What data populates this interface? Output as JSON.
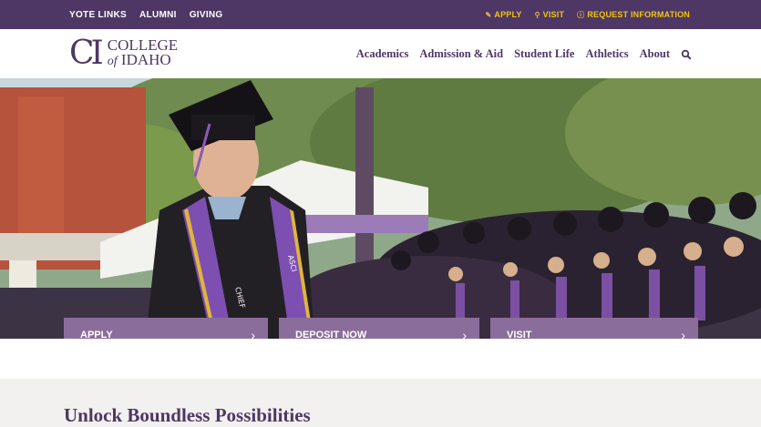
{
  "topbar": {
    "left_links": [
      "YOTE LINKS",
      "ALUMNI",
      "GIVING"
    ],
    "right_links": [
      {
        "label": "APPLY",
        "icon": "pencil-icon"
      },
      {
        "label": "VISIT",
        "icon": "map-pin-icon"
      },
      {
        "label": "REQUEST INFORMATION",
        "icon": "info-icon"
      }
    ],
    "colors": {
      "bar": "#4e3764",
      "right_link": "#f1c40f"
    }
  },
  "header": {
    "logo": {
      "mark": "CI",
      "line1": "COLLEGE",
      "of": "of",
      "line2": "IDAHO"
    },
    "nav": [
      "Academics",
      "Admission & Aid",
      "Student Life",
      "Athletics",
      "About"
    ],
    "search_icon": "search-icon"
  },
  "hero": {
    "sash_left": "CHIEF",
    "sash_right": "ASCI"
  },
  "cta": {
    "apply": "APPLY",
    "deposit": "DEPOSIT NOW",
    "visit": "VISIT",
    "chevron": "›",
    "color": "#8b6d9b"
  },
  "section": {
    "heading": "Unlock Boundless Possibilities"
  }
}
